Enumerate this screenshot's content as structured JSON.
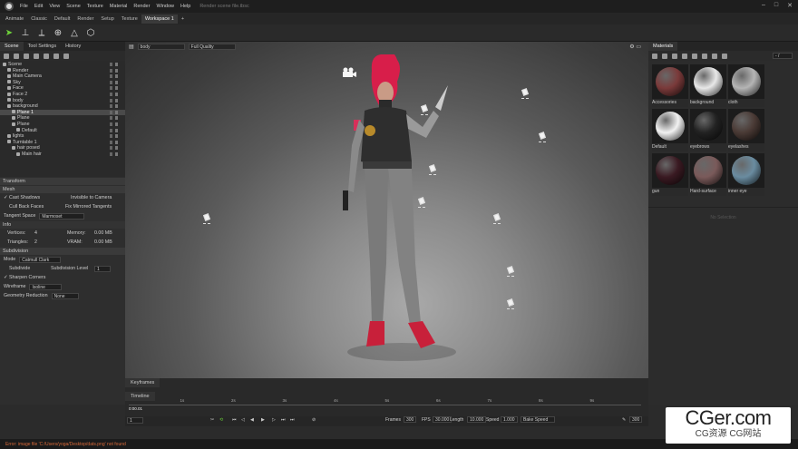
{
  "app": {
    "title": "Render scene file.tbsc"
  },
  "menu": [
    "File",
    "Edit",
    "View",
    "Scene",
    "Texture",
    "Material",
    "Render",
    "Window",
    "Help"
  ],
  "workspaces": [
    "Animate",
    "Classic",
    "Default",
    "Render",
    "Setup",
    "Texture",
    "Workspace 1",
    "+"
  ],
  "left_tabs": [
    "Scene",
    "Tool Settings",
    "History"
  ],
  "tree": [
    {
      "label": "Scene",
      "indent": 0
    },
    {
      "label": "Render",
      "indent": 1
    },
    {
      "label": "Main Camera",
      "indent": 1
    },
    {
      "label": "Sky",
      "indent": 1
    },
    {
      "label": "Face",
      "indent": 1
    },
    {
      "label": "Face 2",
      "indent": 1
    },
    {
      "label": "body",
      "indent": 1
    },
    {
      "label": "background",
      "indent": 1
    },
    {
      "label": "Plane 1",
      "indent": 2,
      "selected": true
    },
    {
      "label": "Plane",
      "indent": 2
    },
    {
      "label": "Plane",
      "indent": 2
    },
    {
      "label": "Default",
      "indent": 3
    },
    {
      "label": "lights",
      "indent": 1
    },
    {
      "label": "Turntable 1",
      "indent": 1
    },
    {
      "label": "hair posed",
      "indent": 2
    },
    {
      "label": "Main hair",
      "indent": 3
    }
  ],
  "props": {
    "transform_header": "Transform",
    "mesh_header": "Mesh",
    "cast_shadows": "Cast Shadows",
    "invisible_to_camera": "Invisible to Camera",
    "cull_back_faces": "Cull Back Faces",
    "fix_mirrored": "Fix Mirrored Tangents",
    "tangent_space_label": "Tangent Space",
    "tangent_space_value": "Marmoset",
    "info_header": "Info",
    "vertices_label": "Vertices:",
    "vertices_value": "4",
    "memory_label": "Memory:",
    "memory_value": "0.00 MB",
    "triangles_label": "Triangles:",
    "triangles_value": "2",
    "vram_label": "VRAM:",
    "vram_value": "0.00 MB",
    "subdivision_header": "Subdivision",
    "mode_label": "Mode",
    "mode_value": "Catmull Clark",
    "subdivide": "Subdivide",
    "subdiv_level_label": "Subdivision Level",
    "subdiv_level_value": "1",
    "sharpen_corners": "Sharpen Corners",
    "wireframe_label": "Wireframe",
    "wireframe_value": "Isoline",
    "geo_reduction_label": "Geometry Reduction",
    "geo_reduction_value": "None"
  },
  "viewport": {
    "object_select": "body",
    "quality_select": "Full Quality"
  },
  "materials": {
    "tab": "Materials",
    "search_placeholder": "- /",
    "items": [
      {
        "label": "Accessories",
        "color": "#7a3a3a"
      },
      {
        "label": "background",
        "color": "#e8e8e8"
      },
      {
        "label": "cloth",
        "color": "#b5b5b5"
      },
      {
        "label": "Default",
        "color": "#f2f2f2"
      },
      {
        "label": "eyebrows",
        "color": "#222222"
      },
      {
        "label": "eyelashes",
        "color": "#4a3a35"
      },
      {
        "label": "gun",
        "color": "#3a1a22"
      },
      {
        "label": "Hard-surface",
        "color": "#7a5a5a"
      },
      {
        "label": "inner eye",
        "color": "#6a8ca0"
      }
    ],
    "no_selection": "No Selection"
  },
  "timeline": {
    "tabs": [
      "Keyframes",
      "Timeline"
    ],
    "current_time": "0:00.01",
    "frame_field": "1",
    "ticks": [
      "1s",
      "2s",
      "3s",
      "4s",
      "5s",
      "6s",
      "7s",
      "8s",
      "9s"
    ],
    "frames_label": "Frames",
    "frames_value": "300",
    "fps_label": "FPS",
    "fps_value": "30.000",
    "length_label": "Length",
    "length_value": "10.000",
    "speed_label": "Speed",
    "speed_value": "1.000",
    "bake_speed": "Bake Speed",
    "end_value": "300"
  },
  "status": {
    "error": "Error: image file 'C:/Users/yoga/Desktop/dats.png' not found"
  },
  "watermark": {
    "line1": "CGer.com",
    "line2": "CG资源 CG网站"
  }
}
